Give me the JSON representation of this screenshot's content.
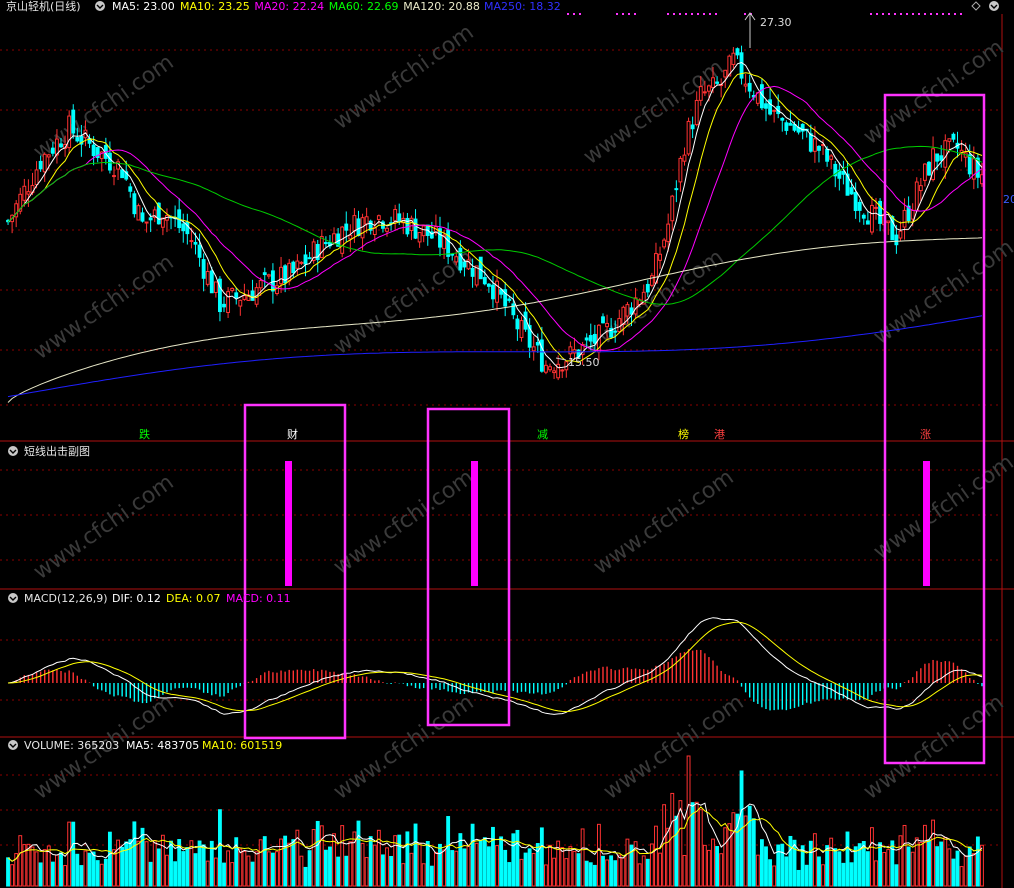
{
  "header": {
    "stock_name": "京山轻机(日线)",
    "ma_items": [
      {
        "label": "MA5: 23.00",
        "color": "#ffffff"
      },
      {
        "label": "MA10: 23.25",
        "color": "#ffff00"
      },
      {
        "label": "MA20: 22.24",
        "color": "#ff00ff"
      },
      {
        "label": "MA60: 22.69",
        "color": "#00ff00"
      },
      {
        "label": "MA120: 20.88",
        "color": "#e8e8c8"
      },
      {
        "label": "MA250: 18.32",
        "color": "#3030ff"
      }
    ]
  },
  "price_annotations": {
    "high": "27.30",
    "low": "15.50",
    "right_edge": "20"
  },
  "signal_markers": [
    {
      "text": "跌",
      "color": "#00ff00"
    },
    {
      "text": "财",
      "color": "#ffffff"
    },
    {
      "text": "减",
      "color": "#00ff00"
    },
    {
      "text": "榜",
      "color": "#ffff00"
    },
    {
      "text": "港",
      "color": "#ff4040"
    },
    {
      "text": "涨",
      "color": "#ff4040"
    }
  ],
  "sub_panel": {
    "title": "短线出击副图"
  },
  "macd": {
    "title": "MACD(12,26,9)",
    "dif": "DIF: 0.12",
    "dea": "DEA: 0.07",
    "macd": "MACD: 0.11"
  },
  "volume": {
    "title": "VOLUME: 365203",
    "ma5": "MA5: 483705",
    "ma10": "MA10: 601519"
  },
  "watermark": "www.cfchi.com",
  "colors": {
    "up": "#ff3232",
    "down": "#00ffff",
    "grid": "#8b0000",
    "highlight_box": "#ff33ff",
    "signal_bar": "#ff00ff"
  },
  "chart_data": {
    "type": "candlestick",
    "title": "京山轻机(日线)",
    "price_range": [
      15.5,
      27.3
    ],
    "annotated_high": 27.3,
    "annotated_low": 15.5,
    "moving_averages": {
      "MA5": 23.0,
      "MA10": 23.25,
      "MA20": 22.24,
      "MA60": 22.69,
      "MA120": 20.88,
      "MA250": 18.32
    },
    "macd": {
      "params": "12,26,9",
      "DIF": 0.12,
      "DEA": 0.07,
      "MACD": 0.11
    },
    "volume": {
      "VOLUME": 365203,
      "MA5": 483705,
      "MA10": 601519
    },
    "signals": [
      "跌",
      "财",
      "减",
      "榜",
      "港",
      "涨"
    ],
    "price_path": [
      [
        0,
        21.4
      ],
      [
        8,
        23.5
      ],
      [
        15,
        24.6
      ],
      [
        22,
        23.8
      ],
      [
        28,
        23.2
      ],
      [
        33,
        21.3
      ],
      [
        38,
        21.8
      ],
      [
        45,
        20.8
      ],
      [
        52,
        18.6
      ],
      [
        58,
        18.9
      ],
      [
        64,
        19.3
      ],
      [
        70,
        19.6
      ],
      [
        76,
        20.5
      ],
      [
        82,
        21.1
      ],
      [
        90,
        21.6
      ],
      [
        97,
        21.4
      ],
      [
        104,
        20.9
      ],
      [
        110,
        20.3
      ],
      [
        118,
        19.4
      ],
      [
        126,
        17.6
      ],
      [
        132,
        16.5
      ],
      [
        138,
        16.8
      ],
      [
        146,
        17.5
      ],
      [
        152,
        18.4
      ],
      [
        158,
        19.4
      ],
      [
        162,
        21.3
      ],
      [
        166,
        24.1
      ],
      [
        170,
        25.7
      ],
      [
        175,
        26.1
      ],
      [
        178,
        26.9
      ],
      [
        182,
        26.1
      ],
      [
        187,
        25.1
      ],
      [
        193,
        24.6
      ],
      [
        199,
        23.9
      ],
      [
        205,
        22.7
      ],
      [
        210,
        21.9
      ],
      [
        214,
        21.3
      ],
      [
        218,
        20.9
      ],
      [
        222,
        22.1
      ],
      [
        227,
        23.6
      ],
      [
        233,
        23.9
      ],
      [
        238,
        23.0
      ]
    ]
  }
}
